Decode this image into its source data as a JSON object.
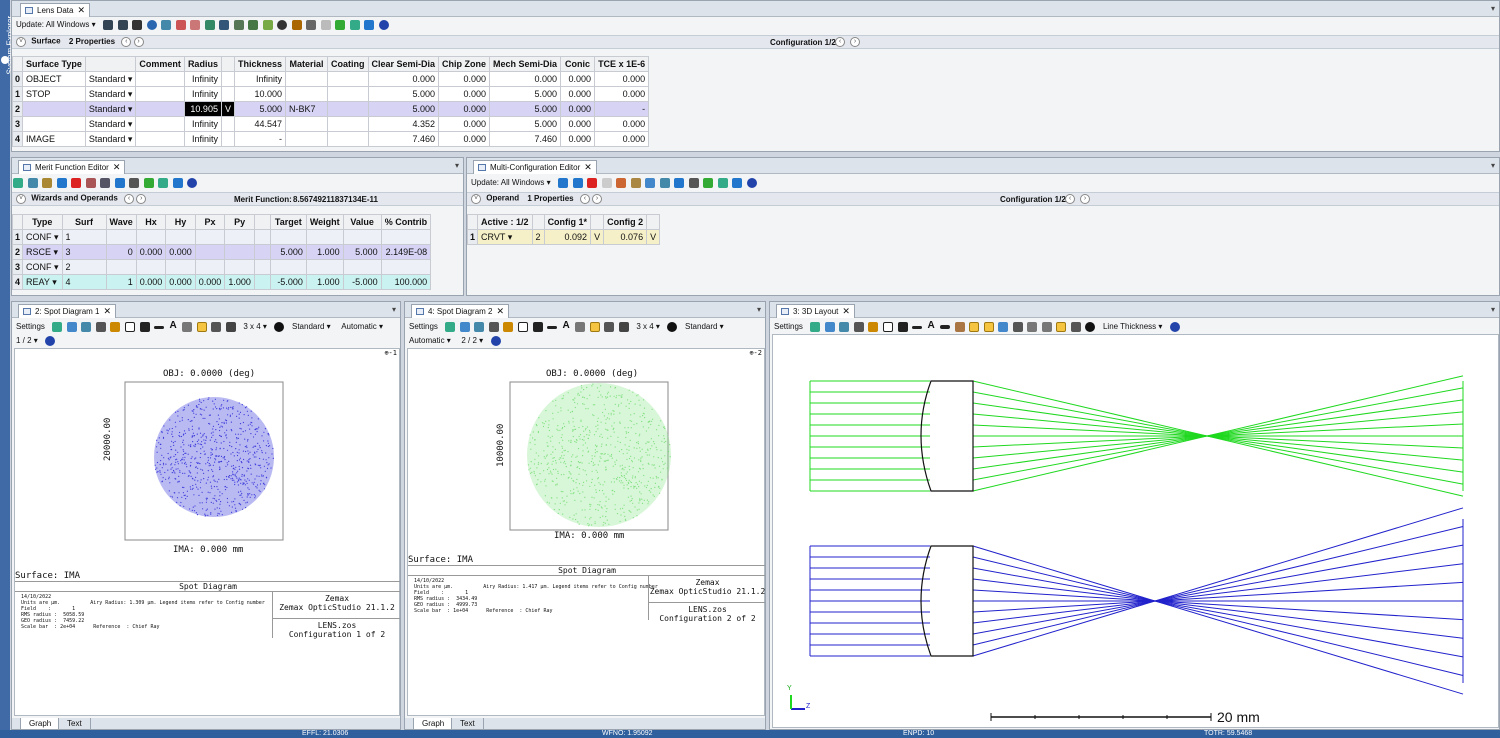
{
  "sidebar": {
    "label": "System Explorer"
  },
  "lens_data": {
    "tab": "Lens Data",
    "update": "Update: All Windows ▾",
    "surface_label": "Surface",
    "properties": "2 Properties",
    "config": "Configuration 1/2",
    "headers": [
      "",
      "Surface Type",
      "",
      "Comment",
      "Radius",
      "",
      "Thickness",
      "Material",
      "Coating",
      "Clear Semi-Dia",
      "Chip Zone",
      "Mech Semi-Dia",
      "Conic",
      "TCE x 1E-6"
    ],
    "rows": [
      [
        "0",
        "OBJECT",
        "Standard ▾",
        "",
        "Infinity",
        "",
        "Infinity",
        "",
        "",
        "0.000",
        "0.000",
        "0.000",
        "0.000",
        "0.000"
      ],
      [
        "1",
        "STOP",
        "Standard ▾",
        "",
        "Infinity",
        "",
        "10.000",
        "",
        "",
        "5.000",
        "0.000",
        "5.000",
        "0.000",
        "0.000"
      ],
      [
        "2",
        "",
        "Standard ▾",
        "",
        "10.905",
        "V",
        "5.000",
        "N-BK7",
        "",
        "5.000",
        "0.000",
        "5.000",
        "0.000",
        "-"
      ],
      [
        "3",
        "",
        "Standard ▾",
        "",
        "Infinity",
        "",
        "44.547",
        "",
        "",
        "4.352",
        "0.000",
        "5.000",
        "0.000",
        "0.000"
      ],
      [
        "4",
        "IMAGE",
        "Standard ▾",
        "",
        "Infinity",
        "",
        "-",
        "",
        "",
        "7.460",
        "0.000",
        "7.460",
        "0.000",
        "0.000"
      ]
    ]
  },
  "merit": {
    "tab": "Merit Function Editor",
    "wizards": "Wizards and Operands",
    "mf_label": "Merit Function:",
    "mf_value": "8.56749211837134E-11",
    "headers": [
      "",
      "Type",
      "Surf",
      "Wave",
      "Hx",
      "Hy",
      "Px",
      "Py",
      "",
      "Target",
      "Weight",
      "Value",
      "% Contrib"
    ],
    "rows": [
      [
        "1",
        "CONF ▾",
        "1",
        "",
        "",
        "",
        "",
        "",
        "",
        "",
        "",
        "",
        ""
      ],
      [
        "2",
        "RSCE ▾",
        "3",
        "0",
        "0.000",
        "0.000",
        "",
        "",
        "",
        "5.000",
        "1.000",
        "5.000",
        "2.149E-08"
      ],
      [
        "3",
        "CONF ▾",
        "2",
        "",
        "",
        "",
        "",
        "",
        "",
        "",
        "",
        "",
        ""
      ],
      [
        "4",
        "REAY ▾",
        "4",
        "1",
        "0.000",
        "0.000",
        "0.000",
        "1.000",
        "",
        "-5.000",
        "1.000",
        "-5.000",
        "100.000"
      ]
    ]
  },
  "mce": {
    "tab": "Multi-Configuration Editor",
    "update": "Update: All Windows ▾",
    "operand": "Operand",
    "properties": "1 Properties",
    "config": "Configuration 1/2",
    "headers": [
      "",
      "Active : 1/2",
      "",
      "Config 1*",
      "",
      "Config 2",
      ""
    ],
    "row": [
      "1",
      "CRVT ▾",
      "2",
      "0.092",
      "V",
      "0.076",
      "V"
    ]
  },
  "spot1": {
    "tab": "2: Spot Diagram 1",
    "settings": "Settings",
    "grid": "3 x 4 ▾",
    "standard": "Standard ▾",
    "automatic": "Automatic ▾",
    "page": "1 / 2 ▾",
    "marker": "⊕-1",
    "obj": "OBJ: 0.0000 (deg)",
    "scale": "20000.00",
    "ima": "IMA: 0.000 mm",
    "surface": "Surface: IMA",
    "box_title": "Spot Diagram",
    "info_lines": [
      "14/10/2022",
      "Units are µm.          Airy Radius: 1.309 µm. Legend items refer to Config number",
      "Field    :       1",
      "RMS radius :  5058.59",
      "GEO radius :  7459.22",
      "Scale bar  : 2e+04      Reference  : Chief Ray"
    ],
    "company": "Zemax",
    "product": "Zemax OpticStudio 21.1.2",
    "file": "LENS.zos",
    "config": "Configuration 1 of 2",
    "bottom_tabs": [
      "Graph",
      "Text"
    ],
    "color": "#3a3adb"
  },
  "spot2": {
    "tab": "4: Spot Diagram 2",
    "settings": "Settings",
    "grid": "3 x 4 ▾",
    "standard": "Standard ▾",
    "automatic": "Automatic ▾",
    "page": "2 / 2 ▾",
    "marker": "⊕-2",
    "obj": "OBJ: 0.0000 (deg)",
    "scale": "10000.00",
    "ima": "IMA: 0.000 mm",
    "surface": "Surface: IMA",
    "box_title": "Spot Diagram",
    "info_lines": [
      "14/10/2022",
      "Units are µm.          Airy Radius: 1.417 µm. Legend items refer to Config number",
      "Field    :       1",
      "RMS radius :  3434.49",
      "GEO radius :  4999.73",
      "Scale bar  : 1e+04      Reference  : Chief Ray"
    ],
    "company": "Zemax",
    "product": "Zemax OpticStudio 21.1.2",
    "file": "LENS.zos",
    "config": "Configuration 2 of 2",
    "bottom_tabs": [
      "Graph",
      "Text"
    ],
    "color": "#7fe07f"
  },
  "layout3d": {
    "tab": "3: 3D Layout",
    "settings": "Settings",
    "line_thickness": "Line Thickness ▾",
    "scale_label": "20 mm",
    "axis_y": "Y",
    "axis_z": "Z",
    "colors": {
      "config1": "#1fd81f",
      "config2": "#2222cc"
    }
  },
  "statusbar": {
    "effl": "EFFL: 21.0306",
    "wfno": "WFNO: 1.95092",
    "enpd": "ENPD: 10",
    "totr": "TOTR: 59.5468"
  }
}
